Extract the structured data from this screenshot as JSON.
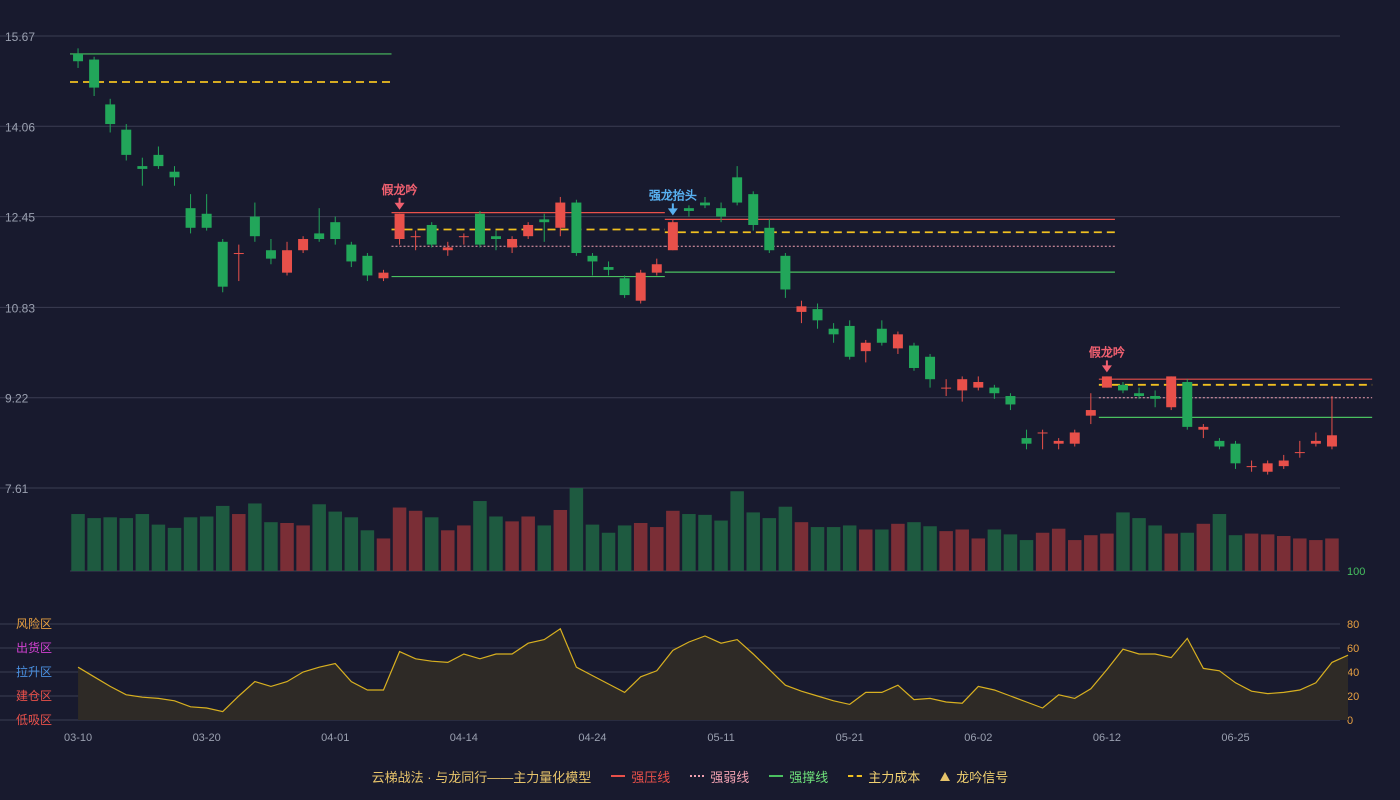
{
  "colors": {
    "up": "#e8504a",
    "down": "#22a65a",
    "pressure": "#e8504a",
    "weak": "#f0a0b0",
    "support": "#4ac060",
    "cost": "#f0c020",
    "indicator": "#d8b020",
    "grid": "#3a3d52",
    "axis_text": "#9aa0b0"
  },
  "legend": {
    "title": "云梯战法 · 与龙同行——主力量化模型",
    "pressure": "强压线",
    "weak": "强弱线",
    "support": "强撑线",
    "cost": "主力成本",
    "signal": "龙吟信号"
  },
  "chart_data": {
    "type": "candlestick",
    "price_axis": {
      "ticks": [
        15.67,
        14.06,
        12.45,
        10.83,
        9.22,
        7.61
      ],
      "range": [
        7.61,
        15.67
      ]
    },
    "dates": [
      "03-10",
      "03-11",
      "03-12",
      "03-13",
      "03-14",
      "03-17",
      "03-18",
      "03-19",
      "03-20",
      "03-21",
      "03-24",
      "03-25",
      "03-26",
      "03-27",
      "03-28",
      "03-31",
      "04-01",
      "04-02",
      "04-03",
      "04-07",
      "04-08",
      "04-09",
      "04-10",
      "04-11",
      "04-14",
      "04-15",
      "04-16",
      "04-17",
      "04-18",
      "04-21",
      "04-22",
      "04-23",
      "04-24",
      "04-25",
      "04-28",
      "04-29",
      "04-30",
      "05-06",
      "05-07",
      "05-08",
      "05-09",
      "05-12",
      "05-13",
      "05-14",
      "05-15",
      "05-16",
      "05-19",
      "05-20",
      "05-21",
      "05-22",
      "05-23",
      "05-26",
      "05-27",
      "05-28",
      "05-29",
      "05-30",
      "06-02",
      "06-03",
      "06-04",
      "06-05",
      "06-06",
      "06-09",
      "06-10",
      "06-11",
      "06-12",
      "06-13",
      "06-16",
      "06-17",
      "06-18",
      "06-19",
      "06-20",
      "06-23",
      "06-24",
      "06-25",
      "06-26",
      "06-27",
      "06-30",
      "07-01",
      "07-02",
      "07-03",
      "07-04"
    ],
    "date_labels": [
      "03-10",
      "03-20",
      "04-01",
      "04-14",
      "04-24",
      "05-11",
      "05-21",
      "06-02",
      "06-12",
      "06-25"
    ],
    "date_label_index": [
      0,
      8,
      16,
      24,
      32,
      40,
      48,
      56,
      64,
      72
    ],
    "ohlc": [
      [
        15.35,
        15.22,
        15.45,
        15.1
      ],
      [
        15.25,
        14.75,
        15.3,
        14.6
      ],
      [
        14.45,
        14.1,
        14.55,
        13.95
      ],
      [
        14.0,
        13.55,
        14.1,
        13.45
      ],
      [
        13.35,
        13.3,
        13.5,
        13.0
      ],
      [
        13.55,
        13.35,
        13.7,
        13.3
      ],
      [
        13.25,
        13.15,
        13.35,
        13.0
      ],
      [
        12.6,
        12.25,
        12.85,
        12.15
      ],
      [
        12.5,
        12.25,
        12.85,
        12.2
      ],
      [
        12.0,
        11.2,
        12.05,
        11.1
      ],
      [
        11.8,
        11.8,
        11.95,
        11.3
      ],
      [
        12.45,
        12.1,
        12.7,
        12.0
      ],
      [
        11.85,
        11.7,
        12.05,
        11.6
      ],
      [
        11.45,
        11.85,
        12.0,
        11.4
      ],
      [
        11.85,
        12.05,
        12.1,
        11.8
      ],
      [
        12.15,
        12.05,
        12.6,
        12.0
      ],
      [
        12.35,
        12.05,
        12.45,
        11.95
      ],
      [
        11.95,
        11.65,
        12.0,
        11.55
      ],
      [
        11.75,
        11.4,
        11.8,
        11.3
      ],
      [
        11.35,
        11.45,
        11.5,
        11.3
      ],
      [
        12.05,
        12.5,
        12.5,
        11.95
      ],
      [
        12.1,
        12.1,
        12.2,
        11.85
      ],
      [
        12.3,
        11.95,
        12.35,
        11.9
      ],
      [
        11.85,
        11.9,
        12.0,
        11.75
      ],
      [
        12.1,
        12.1,
        12.15,
        11.95
      ],
      [
        12.5,
        11.95,
        12.55,
        11.9
      ],
      [
        12.1,
        12.05,
        12.2,
        11.85
      ],
      [
        11.9,
        12.05,
        12.1,
        11.8
      ],
      [
        12.1,
        12.3,
        12.35,
        12.05
      ],
      [
        12.4,
        12.35,
        12.5,
        12.0
      ],
      [
        12.25,
        12.7,
        12.8,
        12.1
      ],
      [
        12.7,
        11.8,
        12.75,
        11.75
      ],
      [
        11.75,
        11.65,
        11.8,
        11.4
      ],
      [
        11.55,
        11.5,
        11.65,
        11.4
      ],
      [
        11.35,
        11.05,
        11.4,
        11.0
      ],
      [
        10.95,
        11.45,
        11.5,
        10.9
      ],
      [
        11.45,
        11.6,
        11.7,
        11.4
      ],
      [
        11.85,
        12.35,
        12.4,
        11.85
      ],
      [
        12.6,
        12.55,
        12.65,
        12.45
      ],
      [
        12.7,
        12.65,
        12.8,
        12.6
      ],
      [
        12.6,
        12.45,
        12.7,
        12.35
      ],
      [
        13.15,
        12.7,
        13.35,
        12.65
      ],
      [
        12.85,
        12.3,
        12.9,
        12.2
      ],
      [
        12.25,
        11.85,
        12.4,
        11.8
      ],
      [
        11.75,
        11.15,
        11.8,
        11.0
      ],
      [
        10.75,
        10.85,
        10.95,
        10.55
      ],
      [
        10.8,
        10.6,
        10.9,
        10.45
      ],
      [
        10.45,
        10.35,
        10.55,
        10.2
      ],
      [
        10.5,
        9.95,
        10.6,
        9.9
      ],
      [
        10.05,
        10.2,
        10.25,
        9.85
      ],
      [
        10.45,
        10.2,
        10.6,
        10.15
      ],
      [
        10.1,
        10.35,
        10.4,
        10.0
      ],
      [
        10.15,
        9.75,
        10.2,
        9.7
      ],
      [
        9.95,
        9.55,
        10.0,
        9.4
      ],
      [
        9.4,
        9.4,
        9.55,
        9.25
      ],
      [
        9.35,
        9.55,
        9.6,
        9.15
      ],
      [
        9.4,
        9.5,
        9.6,
        9.35
      ],
      [
        9.4,
        9.3,
        9.45,
        9.2
      ],
      [
        9.25,
        9.1,
        9.3,
        9.0
      ],
      [
        8.5,
        8.4,
        8.65,
        8.3
      ],
      [
        8.6,
        8.6,
        8.65,
        8.3
      ],
      [
        8.4,
        8.45,
        8.5,
        8.3
      ],
      [
        8.4,
        8.6,
        8.65,
        8.35
      ],
      [
        8.9,
        9.0,
        9.3,
        8.75
      ],
      [
        9.4,
        9.6,
        9.6,
        9.4
      ],
      [
        9.45,
        9.35,
        9.5,
        9.3
      ],
      [
        9.3,
        9.25,
        9.4,
        9.2
      ],
      [
        9.25,
        9.2,
        9.35,
        9.05
      ],
      [
        9.05,
        9.6,
        9.6,
        9.0
      ],
      [
        9.5,
        8.7,
        9.55,
        8.65
      ],
      [
        8.65,
        8.7,
        8.75,
        8.5
      ],
      [
        8.45,
        8.35,
        8.5,
        8.3
      ],
      [
        8.4,
        8.05,
        8.45,
        7.95
      ],
      [
        8.0,
        8.0,
        8.1,
        7.9
      ],
      [
        7.9,
        8.05,
        8.1,
        7.85
      ],
      [
        8.0,
        8.1,
        8.2,
        7.95
      ],
      [
        8.25,
        8.25,
        8.45,
        8.15
      ],
      [
        8.4,
        8.45,
        8.6,
        8.35
      ],
      [
        8.35,
        8.55,
        9.25,
        8.3
      ]
    ],
    "volume_max_label": "100",
    "volume": [
      70,
      65,
      66,
      65,
      70,
      57,
      53,
      66,
      67,
      80,
      70,
      83,
      60,
      59,
      56,
      82,
      73,
      66,
      50,
      40,
      78,
      74,
      66,
      50,
      56,
      86,
      67,
      61,
      67,
      56,
      75,
      102,
      57,
      47,
      56,
      59,
      54,
      74,
      70,
      69,
      62,
      98,
      72,
      65,
      79,
      60,
      54,
      54,
      56,
      51,
      51,
      58,
      60,
      55,
      49,
      51,
      40,
      51,
      45,
      38,
      47,
      52,
      38,
      44,
      46,
      72,
      65,
      56,
      46,
      47,
      58,
      70,
      44,
      46,
      45,
      43,
      40,
      38,
      40,
      58,
      75,
      72,
      93
    ],
    "indicator_axis": {
      "ticks": [
        0,
        20,
        40,
        60,
        80
      ],
      "range": [
        0,
        100
      ]
    },
    "zones": [
      "风险区",
      "出货区",
      "拉升区",
      "建仓区",
      "低吸区"
    ],
    "indicator": [
      44,
      36,
      28,
      21,
      19,
      18,
      16,
      11,
      10,
      7,
      20,
      32,
      28,
      32,
      40,
      44,
      47,
      32,
      25,
      25,
      57,
      51,
      49,
      48,
      55,
      51,
      55,
      55,
      64,
      67,
      76,
      44,
      37,
      30,
      23,
      36,
      41,
      58,
      65,
      70,
      64,
      67,
      55,
      42,
      29,
      24,
      20,
      16,
      13,
      23,
      23,
      29,
      17,
      18,
      15,
      14,
      28,
      25,
      20,
      15,
      10,
      21,
      18,
      26,
      42,
      59,
      55,
      55,
      52,
      68,
      43,
      41,
      31,
      24,
      22,
      23,
      25,
      31,
      48,
      54
    ],
    "levels": [
      {
        "start": 0,
        "end": 19,
        "pressure": null,
        "cost": 14.85,
        "weak": null,
        "support": 15.35
      },
      {
        "start": 20,
        "end": 36,
        "pressure": 12.52,
        "cost": 12.22,
        "weak": 11.92,
        "support": 11.38
      },
      {
        "start": 37,
        "end": 64,
        "pressure": 12.4,
        "cost": 12.17,
        "weak": 11.92,
        "support": 11.46
      },
      {
        "start": 64,
        "end": 80,
        "pressure": 9.55,
        "cost": 9.45,
        "weak": 9.22,
        "support": 8.87
      }
    ],
    "signals": [
      {
        "index": 20,
        "text": "假龙吟",
        "type": "fake"
      },
      {
        "index": 37,
        "text": "强龙抬头",
        "type": "strong"
      },
      {
        "index": 64,
        "text": "假龙吟",
        "type": "fake"
      }
    ]
  }
}
